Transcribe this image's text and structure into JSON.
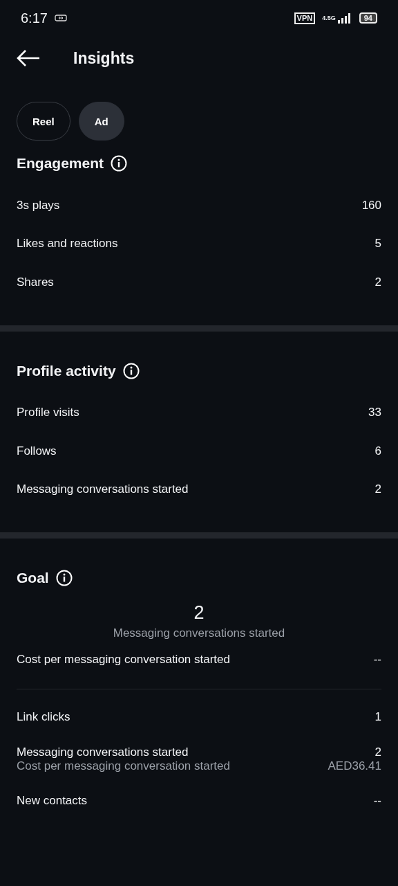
{
  "status_bar": {
    "time": "6:17",
    "vpn": "VPN",
    "network": "4.5G",
    "battery": "94"
  },
  "header": {
    "title": "Insights"
  },
  "tabs": [
    {
      "label": "Reel",
      "selected": false
    },
    {
      "label": "Ad",
      "selected": true
    }
  ],
  "sections": [
    {
      "title": "Engagement",
      "rows": [
        {
          "label": "3s plays",
          "value": "160"
        },
        {
          "label": "Likes and reactions",
          "value": "5"
        },
        {
          "label": "Shares",
          "value": "2"
        }
      ]
    },
    {
      "title": "Profile activity",
      "rows": [
        {
          "label": "Profile visits",
          "value": "33"
        },
        {
          "label": "Follows",
          "value": "6"
        },
        {
          "label": "Messaging conversations started",
          "value": "2"
        }
      ]
    }
  ],
  "goal": {
    "title": "Goal",
    "total": {
      "value": "2",
      "label": "Messaging conversations started"
    },
    "summary_rows": [
      {
        "label": "Cost per messaging conversation started",
        "value": "--"
      }
    ],
    "rows": [
      {
        "label": "Link clicks",
        "value": "1"
      },
      {
        "label": "Messaging conversations started",
        "value": "2",
        "sub_label": "Cost per messaging conversation started",
        "sub_value": "AED36.41"
      },
      {
        "label": "New contacts",
        "value": "--"
      }
    ]
  }
}
